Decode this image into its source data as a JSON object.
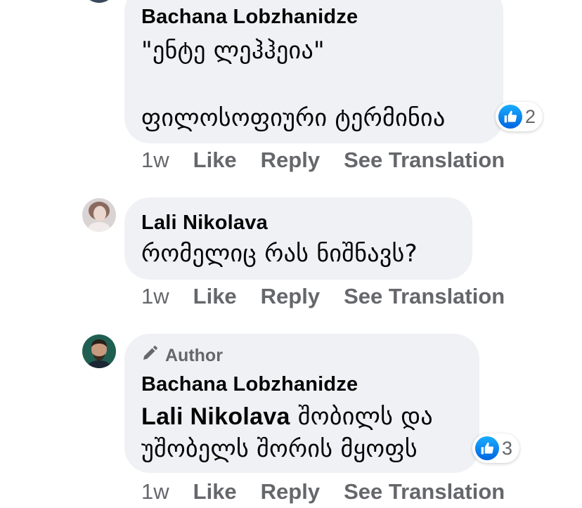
{
  "comments": [
    {
      "author": "Bachana Lobzhanidze",
      "lines": [
        "\"ენტე ლეჰჰეია\"",
        "ფილოსოფიური ტერმინია"
      ],
      "reactions": "2",
      "actions": {
        "time": "1w",
        "like": "Like",
        "reply": "Reply",
        "translate": "See Translation"
      }
    },
    {
      "author": "Lali Nikolava",
      "lines": [
        "რომელიც რას ნიშნავს?"
      ],
      "actions": {
        "time": "1w",
        "like": "Like",
        "reply": "Reply",
        "translate": "See Translation"
      }
    },
    {
      "badge": "Author",
      "author": "Bachana Lobzhanidze",
      "mention": "Lali Nikolava",
      "line1_rest": " შობილს და",
      "line2": "უშობელს შორის მყოფს",
      "reactions": "3",
      "actions": {
        "time": "1w",
        "like": "Like",
        "reply": "Reply",
        "translate": "See Translation"
      }
    }
  ],
  "colors": {
    "bubble": "#eff1f4",
    "secondary_text": "#65676b",
    "like_blue": "#1877f2"
  },
  "icons": [
    "like-icon",
    "pencil-icon"
  ]
}
